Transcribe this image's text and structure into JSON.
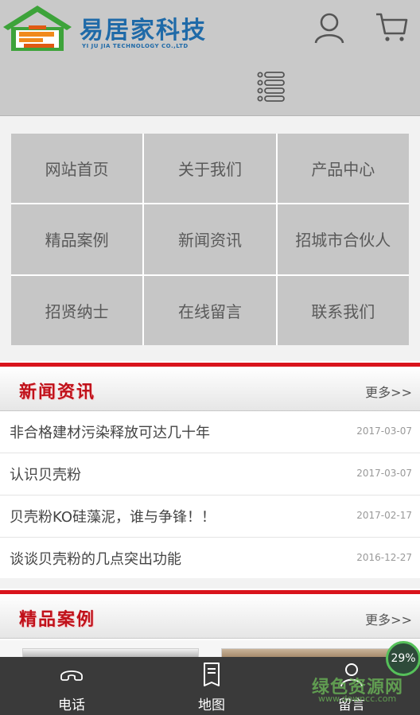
{
  "header": {
    "logo_title": "易居家科技",
    "logo_subtitle": "YI JU JIA TECHNOLOGY CO.,LTD"
  },
  "nav": {
    "items": [
      {
        "label": "网站首页"
      },
      {
        "label": "关于我们"
      },
      {
        "label": "产品中心"
      },
      {
        "label": "精品案例"
      },
      {
        "label": "新闻资讯"
      },
      {
        "label": "招城市合伙人"
      },
      {
        "label": "招贤纳士"
      },
      {
        "label": "在线留言"
      },
      {
        "label": "联系我们"
      }
    ]
  },
  "news": {
    "title": "新闻资讯",
    "more": "更多>>",
    "items": [
      {
        "title": "非合格建材污染释放可达几十年",
        "date": "2017-03-07"
      },
      {
        "title": "认识贝壳粉",
        "date": "2017-03-07"
      },
      {
        "title": "贝壳粉KO硅藻泥，谁与争锋！！",
        "date": "2017-02-17"
      },
      {
        "title": "谈谈贝壳粉的几点突出功能",
        "date": "2016-12-27"
      }
    ]
  },
  "cases": {
    "title": "精品案例",
    "more": "更多>>"
  },
  "bottom_bar": {
    "items": [
      {
        "label": "电话",
        "icon": "phone-icon"
      },
      {
        "label": "地图",
        "icon": "map-icon"
      },
      {
        "label": "留言",
        "icon": "person-icon"
      }
    ]
  },
  "overlay": {
    "progress_text": "29%",
    "progress_value": 0.29,
    "watermark": "绿色资源网",
    "watermark_sub": "www.downcc.com"
  },
  "colors": {
    "accent_red": "#d9141c",
    "logo_blue": "#1f6aa8",
    "logo_green": "#3da33a",
    "bottom_bar": "#3a3a3a"
  }
}
